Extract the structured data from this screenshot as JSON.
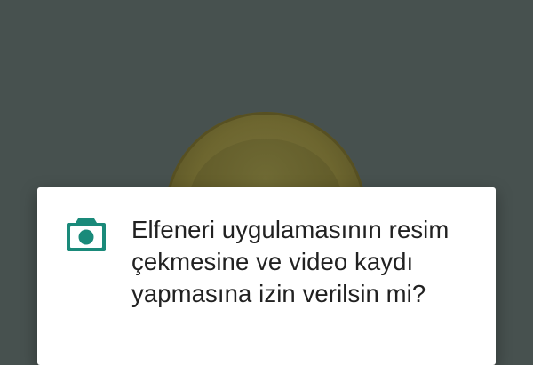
{
  "dialog": {
    "icon": "camera-icon",
    "message": "Elfeneri uygulamasının resim çekmesine ve video kaydı yapmasına izin verilsin mi?"
  },
  "colors": {
    "scrim": "#47514f",
    "dialog_background": "#ffffff",
    "icon_accent": "#1a8a7a",
    "text": "#212121"
  }
}
